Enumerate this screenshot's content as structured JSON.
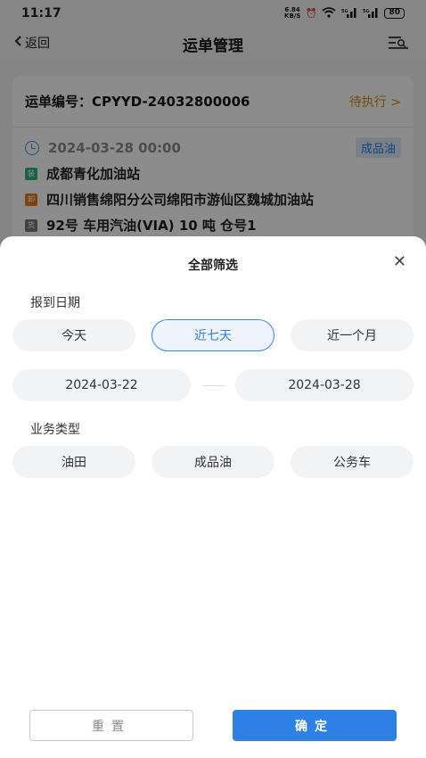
{
  "status_bar": {
    "time": "11:17",
    "net_speed": "6.84 KB/S",
    "battery": "80",
    "signal1": "5G",
    "signal2": "5G"
  },
  "nav": {
    "back_label": "返回",
    "title": "运单管理"
  },
  "order": {
    "number_label": "运单编号：CPYYD-24032800006",
    "status": "待执行",
    "date": "2024-03-28 00:00",
    "type_badge": "成品油",
    "load_tag": "装",
    "load_station": "成都青化加油站",
    "unload_tag": "卸",
    "unload_station": "四川销售绵阳分公司绵阳市游仙区魏城加油站",
    "goods_tag": "货",
    "goods": "92号 车用汽油(VIA) 10 吨 仓号1"
  },
  "filter": {
    "title": "全部筛选",
    "date_section": "报到日期",
    "date_options": [
      "今天",
      "近七天",
      "近一个月"
    ],
    "selected_date_option": "近七天",
    "start_date": "2024-03-22",
    "end_date": "2024-03-28",
    "business_section": "业务类型",
    "business_options": [
      "油田",
      "成品油",
      "公务车"
    ],
    "reset_label": "重置",
    "confirm_label": "确定"
  }
}
